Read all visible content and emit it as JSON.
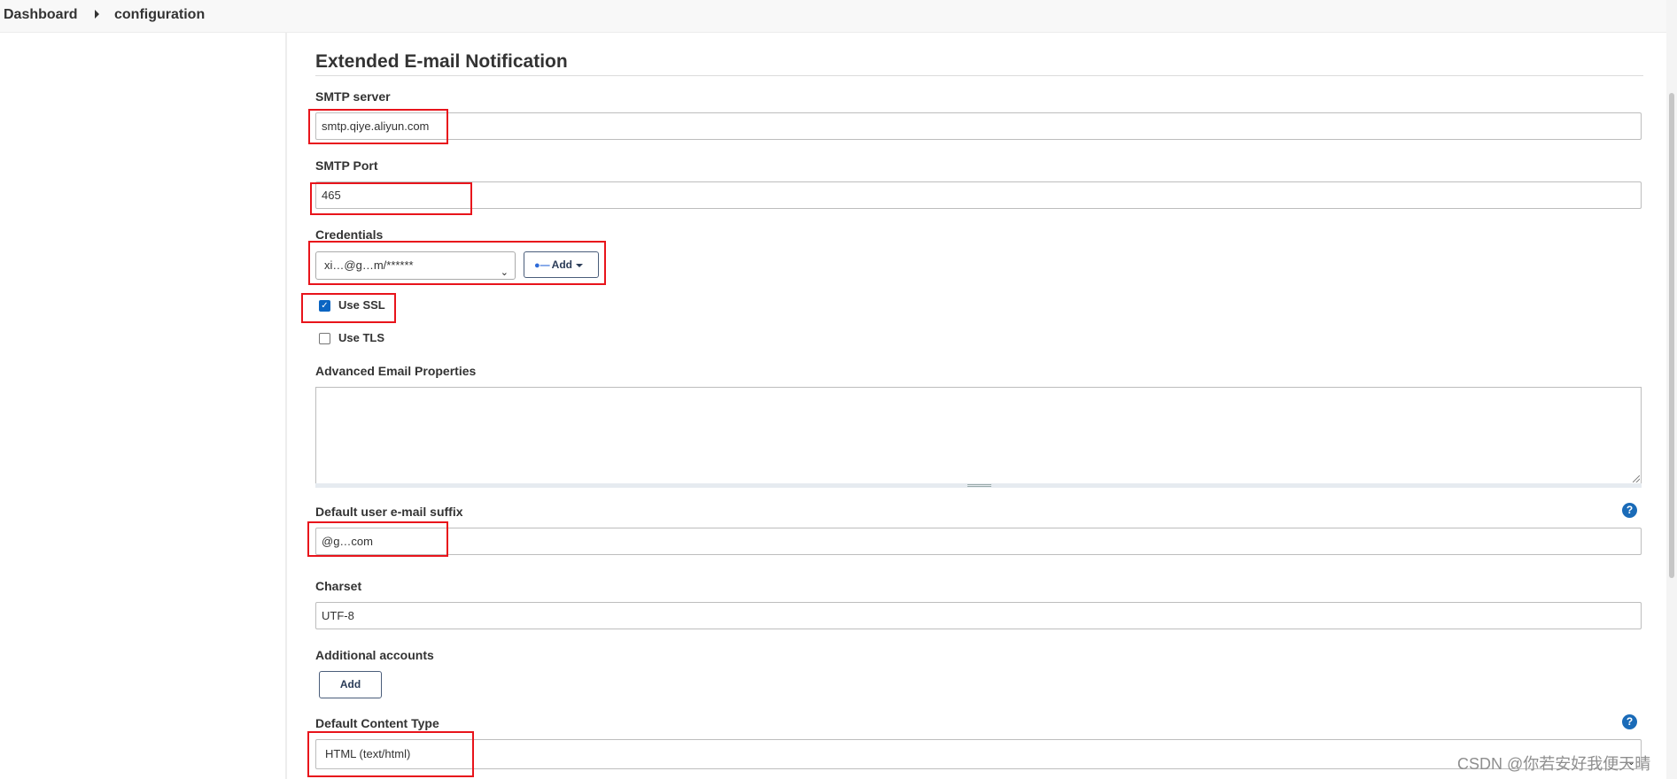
{
  "breadcrumb": {
    "items": [
      "Dashboard",
      "configuration"
    ]
  },
  "section": {
    "title": "Extended E-mail Notification"
  },
  "smtp_server": {
    "label": "SMTP server",
    "value": "smtp.qiye.aliyun.com"
  },
  "smtp_port": {
    "label": "SMTP Port",
    "value": "465"
  },
  "credentials": {
    "label": "Credentials",
    "selected": "xi…@g…m/******",
    "add_label": "Add"
  },
  "use_ssl": {
    "label": "Use SSL",
    "checked": true
  },
  "use_tls": {
    "label": "Use TLS",
    "checked": false
  },
  "advanced_props": {
    "label": "Advanced Email Properties",
    "value": ""
  },
  "email_suffix": {
    "label": "Default user e-mail suffix",
    "value": "@g…com"
  },
  "charset": {
    "label": "Charset",
    "value": "UTF-8"
  },
  "additional_accounts": {
    "label": "Additional accounts",
    "add_label": "Add"
  },
  "content_type": {
    "label": "Default Content Type",
    "selected": "HTML (text/html)"
  },
  "help_glyph": "?",
  "watermark": "CSDN @你若安好我便天晴",
  "colors": {
    "highlight_border": "#e8141b",
    "checkbox_checked": "#0b65c2",
    "help_icon": "#1a6bb8",
    "button_border": "#4a5d7a"
  },
  "icons": [
    "breadcrumb-chevron-icon",
    "key-icon",
    "caret-down-icon",
    "check-icon",
    "help-icon",
    "select-chevron-icon",
    "resize-grip-icon"
  ]
}
